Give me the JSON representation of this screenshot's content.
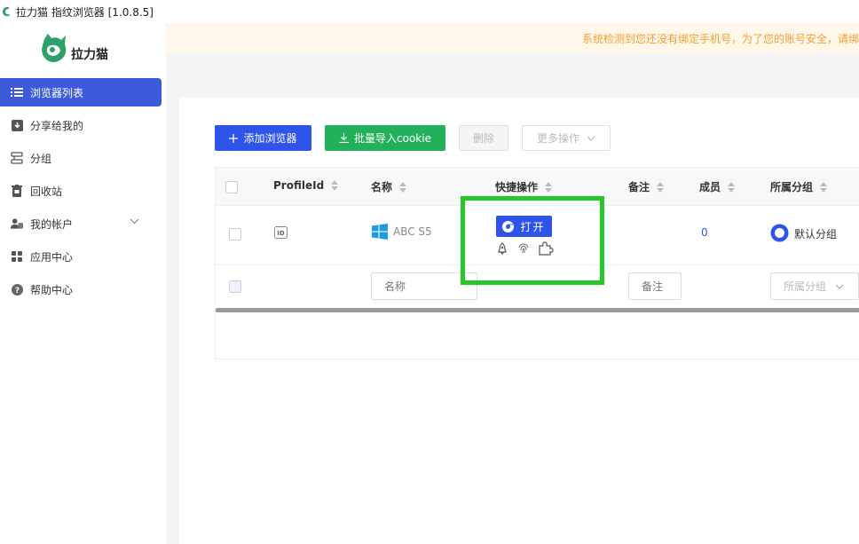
{
  "window": {
    "title": "拉力猫 指纹浏览器  [1.0.8.5]"
  },
  "brand": {
    "logo_text": "拉力猫",
    "color": "#2ea06a"
  },
  "sidebar": {
    "items": [
      {
        "label": "浏览器列表",
        "icon": "list-icon",
        "active": true
      },
      {
        "label": "分享给我的",
        "icon": "download-box-icon"
      },
      {
        "label": "分组",
        "icon": "group-icon"
      },
      {
        "label": "回收站",
        "icon": "trash-icon"
      },
      {
        "label": "我的帐户",
        "icon": "user-group-icon",
        "expandable": true
      },
      {
        "label": "应用中心",
        "icon": "apps-grid-icon"
      },
      {
        "label": "帮助中心",
        "icon": "help-circle-icon"
      }
    ]
  },
  "notice": {
    "text": "系统检测到您还没有绑定手机号，为了您的账号安全，请绑"
  },
  "toolbar": {
    "add_label": "添加浏览器",
    "import_label": "批量导入cookie",
    "delete_label": "删除",
    "more_label": "更多操作"
  },
  "table": {
    "headers": [
      "ProfileId",
      "名称",
      "快捷操作",
      "备注",
      "成员",
      "所属分组"
    ],
    "rows": [
      {
        "profile_icon": "id-badge-icon",
        "os_icon": "windows-icon",
        "name": "ABC S5",
        "open_label": "打开",
        "note": "",
        "members": "0",
        "group": "默认分组"
      }
    ],
    "filters": {
      "name_placeholder": "名称",
      "note_placeholder": "备注",
      "group_placeholder": "所属分组"
    }
  },
  "colors": {
    "primary": "#2f54eb",
    "success": "#22b15a",
    "notice_text": "#f0a030",
    "highlight": "#26c72c"
  }
}
